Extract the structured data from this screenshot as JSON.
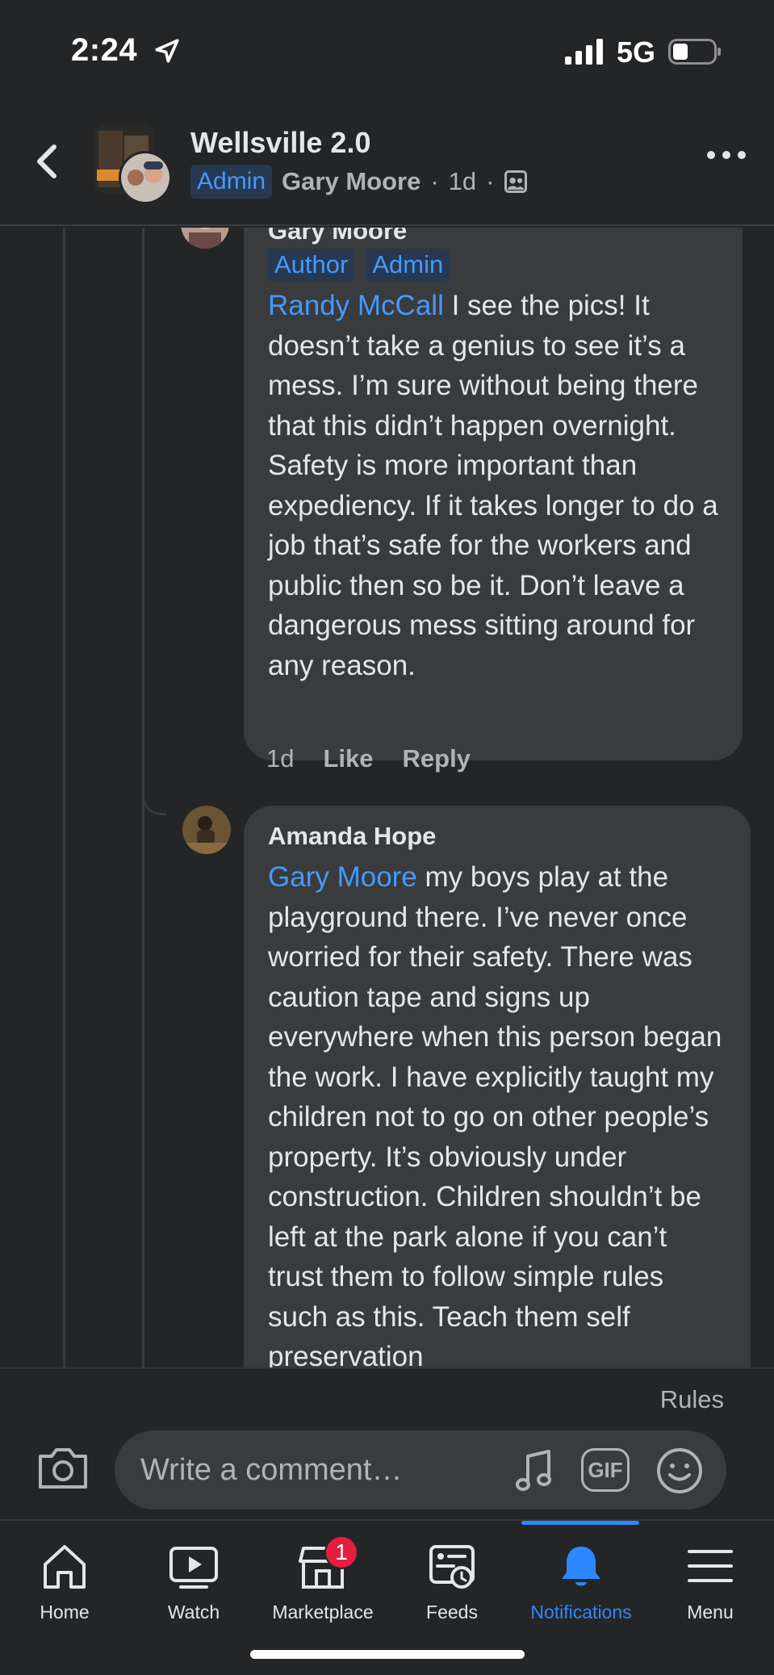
{
  "status_bar": {
    "time": "2:24",
    "network": "5G"
  },
  "header": {
    "group_title": "Wellsville 2.0",
    "badge": "Admin",
    "author": "Gary Moore",
    "time": "1d",
    "separator": "·"
  },
  "comments": [
    {
      "name": "Gary Moore",
      "badges": [
        "Author",
        "Admin"
      ],
      "mention": "Randy McCall",
      "text": " I see the pics! It doesn’t take a genius to see it’s a mess. I’m sure without being there that this didn’t happen overnight. Safety is more important than expediency. If it takes longer to do a job that’s safe for the workers and public then so be it. Don’t leave a dangerous mess sitting around for any reason.",
      "time": "1d",
      "like_label": "Like",
      "reply_label": "Reply"
    },
    {
      "name": "Amanda Hope",
      "mention": "Gary Moore",
      "text": " my boys play at the playground there. I’ve never once worried for their safety. There was caution tape and signs up everywhere when this person began the work. I have explicitly taught my children not to go on other people’s property. It’s obviously under construction. Children shouldn’t be left at the park alone if you can’t trust them to follow simple rules such as this. Teach them self preservation"
    }
  ],
  "composer": {
    "rules_label": "Rules",
    "placeholder": "Write a comment…",
    "gif_label": "GIF"
  },
  "tabbar": {
    "tabs": [
      {
        "label": "Home"
      },
      {
        "label": "Watch"
      },
      {
        "label": "Marketplace",
        "badge": "1"
      },
      {
        "label": "Feeds"
      },
      {
        "label": "Notifications"
      },
      {
        "label": "Menu"
      }
    ],
    "active_color": "#2d88ff"
  },
  "colors": {
    "background": "#242526",
    "bubble": "#3a3b3c",
    "link": "#4599ff",
    "badge_bg": "#263951",
    "notification_red": "#e41e3f"
  }
}
